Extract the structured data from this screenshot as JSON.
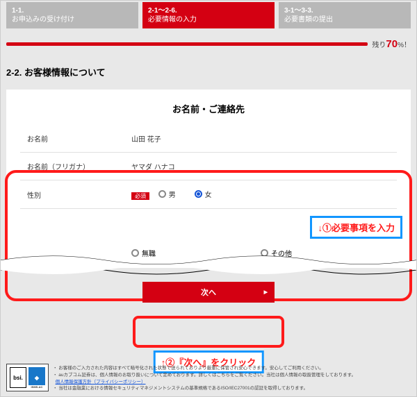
{
  "steps": {
    "s1_num": "1-1.",
    "s1_label": "お申込みの受け付け",
    "s2_num": "2-1～2-6.",
    "s2_label": "必要情報の入力",
    "s3_num": "3-1～3-3.",
    "s3_label": "必要書類の提出"
  },
  "progress": {
    "remain_label": "残り",
    "percent": "70",
    "pct_suffix": "%！"
  },
  "title": "2-2. お客様情報について",
  "card": {
    "heading": "お名前・ご連絡先",
    "name_label": "お名前",
    "name_value": "山田 花子",
    "kana_label": "お名前（フリガナ）",
    "kana_value": "ヤマダ ハナコ",
    "gender_label": "性別",
    "required": "必須",
    "male": "男",
    "female": "女",
    "none": "無職",
    "other": "その他"
  },
  "button": {
    "next": "次へ"
  },
  "annot": {
    "a1": "↓①必要事項を入力",
    "a2": "↑②『次へ』をクリック"
  },
  "footer": {
    "l1": "・ お客様のご入力された内容はすべて暗号化された状態で送られておりより厳重に保管され安心できます。安心してご利用ください。",
    "l2a": "・ auカブコム証券は、個人情報のお取り扱いについて定めております。詳しくはこちらをご覧ください。当社は個人情報の取扱管理をしております。",
    "link": "個人情報保護方針（プライバシーポリシー）",
    "l3": "・ 当社は金融業における情報セキュリティマネジメントシステムの基準規格であるISO/IEC27001の認証を取得しております。"
  }
}
